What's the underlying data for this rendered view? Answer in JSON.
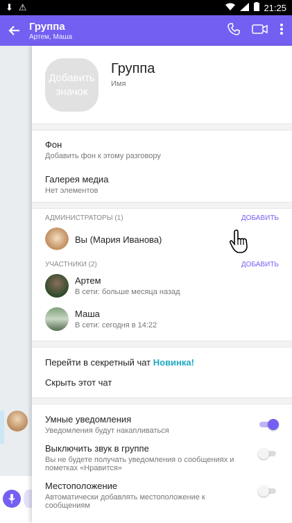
{
  "status_bar": {
    "time": "21:25"
  },
  "appbar": {
    "title": "Группа",
    "subtitle": "Артем, Маша"
  },
  "header": {
    "icon_label": "Добавить значок",
    "group_name": "Группа",
    "name_label": "Имя"
  },
  "settings_top": [
    {
      "title": "Фон",
      "subtitle": "Добавить фон к этому разговору"
    },
    {
      "title": "Галерея медиа",
      "subtitle": "Нет элементов"
    }
  ],
  "admins": {
    "header": "АДМИНИСТРАТОРЫ (1)",
    "add": "ДОБАВИТЬ",
    "items": [
      {
        "name": "Вы (Мария Иванова)"
      }
    ]
  },
  "participants": {
    "header": "УЧАСТНИКИ (2)",
    "add": "ДОБАВИТЬ",
    "items": [
      {
        "name": "Артем",
        "status": "В сети: больше месяца назад"
      },
      {
        "name": "Маша",
        "status": "В сети: сегодня в 14:22"
      }
    ]
  },
  "actions": {
    "secret_chat": "Перейти в секретный чат",
    "new_badge": "Новинка!",
    "hide_chat": "Скрыть этот чат"
  },
  "notifications": [
    {
      "title": "Умные уведомления",
      "subtitle": "Уведомления будут накапливаться",
      "enabled": true
    },
    {
      "title": "Выключить звук в группе",
      "subtitle": "Вы не будете получать уведомления о сообщениях и пометках «Нравится»",
      "enabled": false
    },
    {
      "title": "Местоположение",
      "subtitle": "Автоматически добавлять местоположение к сообщениям",
      "enabled": false
    }
  ],
  "colors": {
    "accent": "#7360f2",
    "new_badge": "#1fa7c2"
  }
}
